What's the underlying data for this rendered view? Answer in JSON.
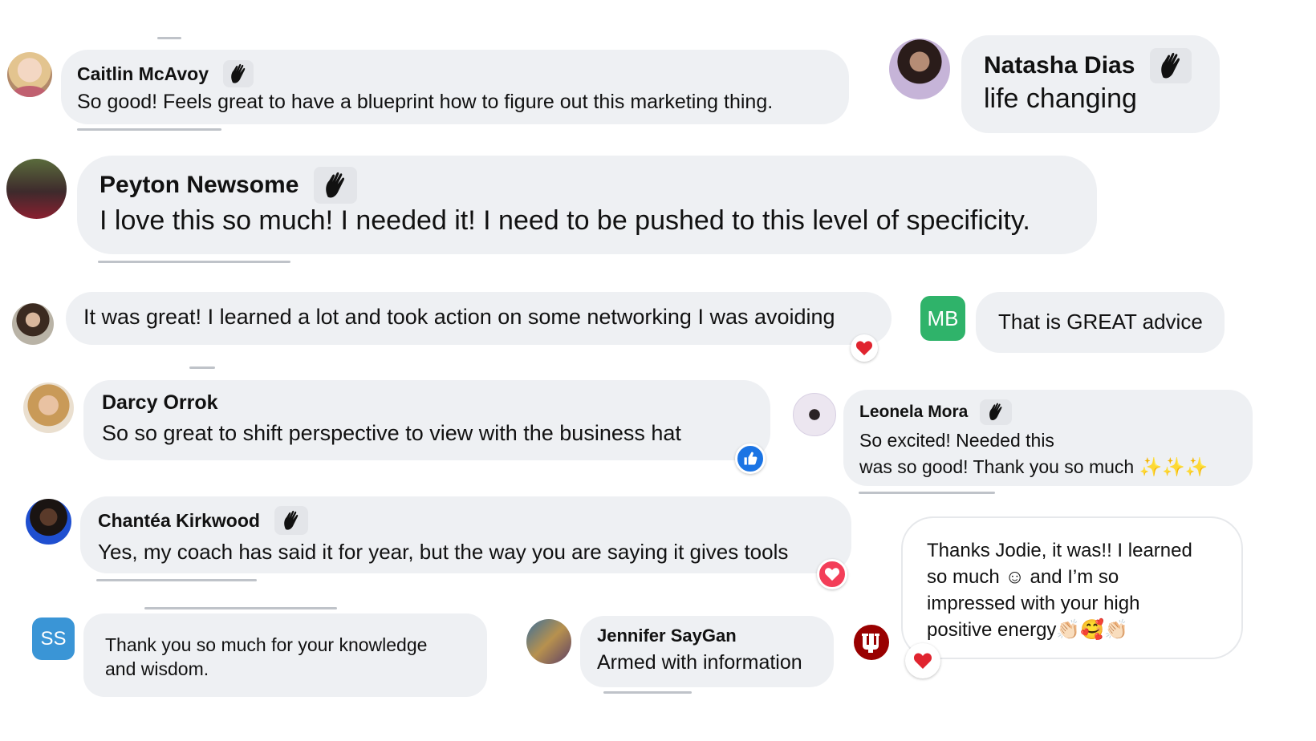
{
  "comments": [
    {
      "id": "caitlin",
      "name": "Caitlin McAvoy",
      "text": "So good! Feels great to have a blueprint how to figure out this marketing thing."
    },
    {
      "id": "natasha",
      "name": "Natasha Dias",
      "text": "life changing"
    },
    {
      "id": "peyton",
      "name": "Peyton Newsome",
      "text": "I love this so much! I needed it! I need to be pushed to this level of specificity."
    },
    {
      "id": "anon1",
      "name": "",
      "text": "It was great! I learned a lot and took action on some networking I was avoiding",
      "reaction": "heart"
    },
    {
      "id": "mb",
      "initials": "MB",
      "avatar_color": "#2fb36a",
      "text": "That is GREAT advice"
    },
    {
      "id": "darcy",
      "name": "Darcy Orrok",
      "text": "So so great to shift perspective to view with the business hat",
      "reaction": "like"
    },
    {
      "id": "leonela",
      "name": "Leonela Mora",
      "text": "So excited! Needed this",
      "text2": "was so good! Thank you so much ✨✨✨"
    },
    {
      "id": "chantea",
      "name": "Chantéa Kirkwood",
      "text": "Yes, my coach has said it for year, but the way you are saying it gives tools",
      "reaction": "love"
    },
    {
      "id": "ss",
      "initials": "SS",
      "avatar_color": "#3a95d6",
      "text": "Thank you so much for your knowledge",
      "text2": "and wisdom."
    },
    {
      "id": "jennifer",
      "name": "Jennifer SayGan",
      "text": "Armed with information"
    },
    {
      "id": "iu",
      "name": "",
      "lines": [
        "Thanks Jodie, it was!! I learned",
        "so much ☺ and I’m so",
        "impressed with your high",
        "positive energy👏🏻🥰👏🏻"
      ],
      "reaction": "heart"
    }
  ],
  "icons": {
    "badge": "wave-hand-icon",
    "heart": "red-heart-icon",
    "like": "thumbs-up-icon",
    "love": "love-heart-icon"
  },
  "colors": {
    "bubble": "#eef0f3",
    "heart": "#e0242f",
    "like": "#1b74e4",
    "badge_bg": "#e3e5e9"
  }
}
